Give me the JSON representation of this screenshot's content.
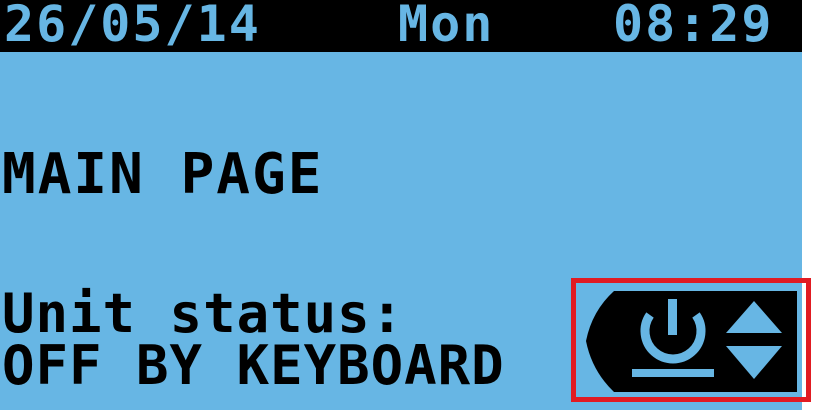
{
  "status_bar": {
    "date": "26/05/14",
    "day": "Mon",
    "time": "08:29"
  },
  "page": {
    "title": "MAIN PAGE"
  },
  "unit": {
    "status_label": "Unit status:",
    "status_value": "OFF BY KEYBOARD"
  },
  "icons": {
    "power": "power-icon",
    "scroll": "up-down-arrows-icon"
  },
  "colors": {
    "lcd_background": "#67b6e4",
    "text": "#000000",
    "highlight_frame": "#e11b22"
  }
}
